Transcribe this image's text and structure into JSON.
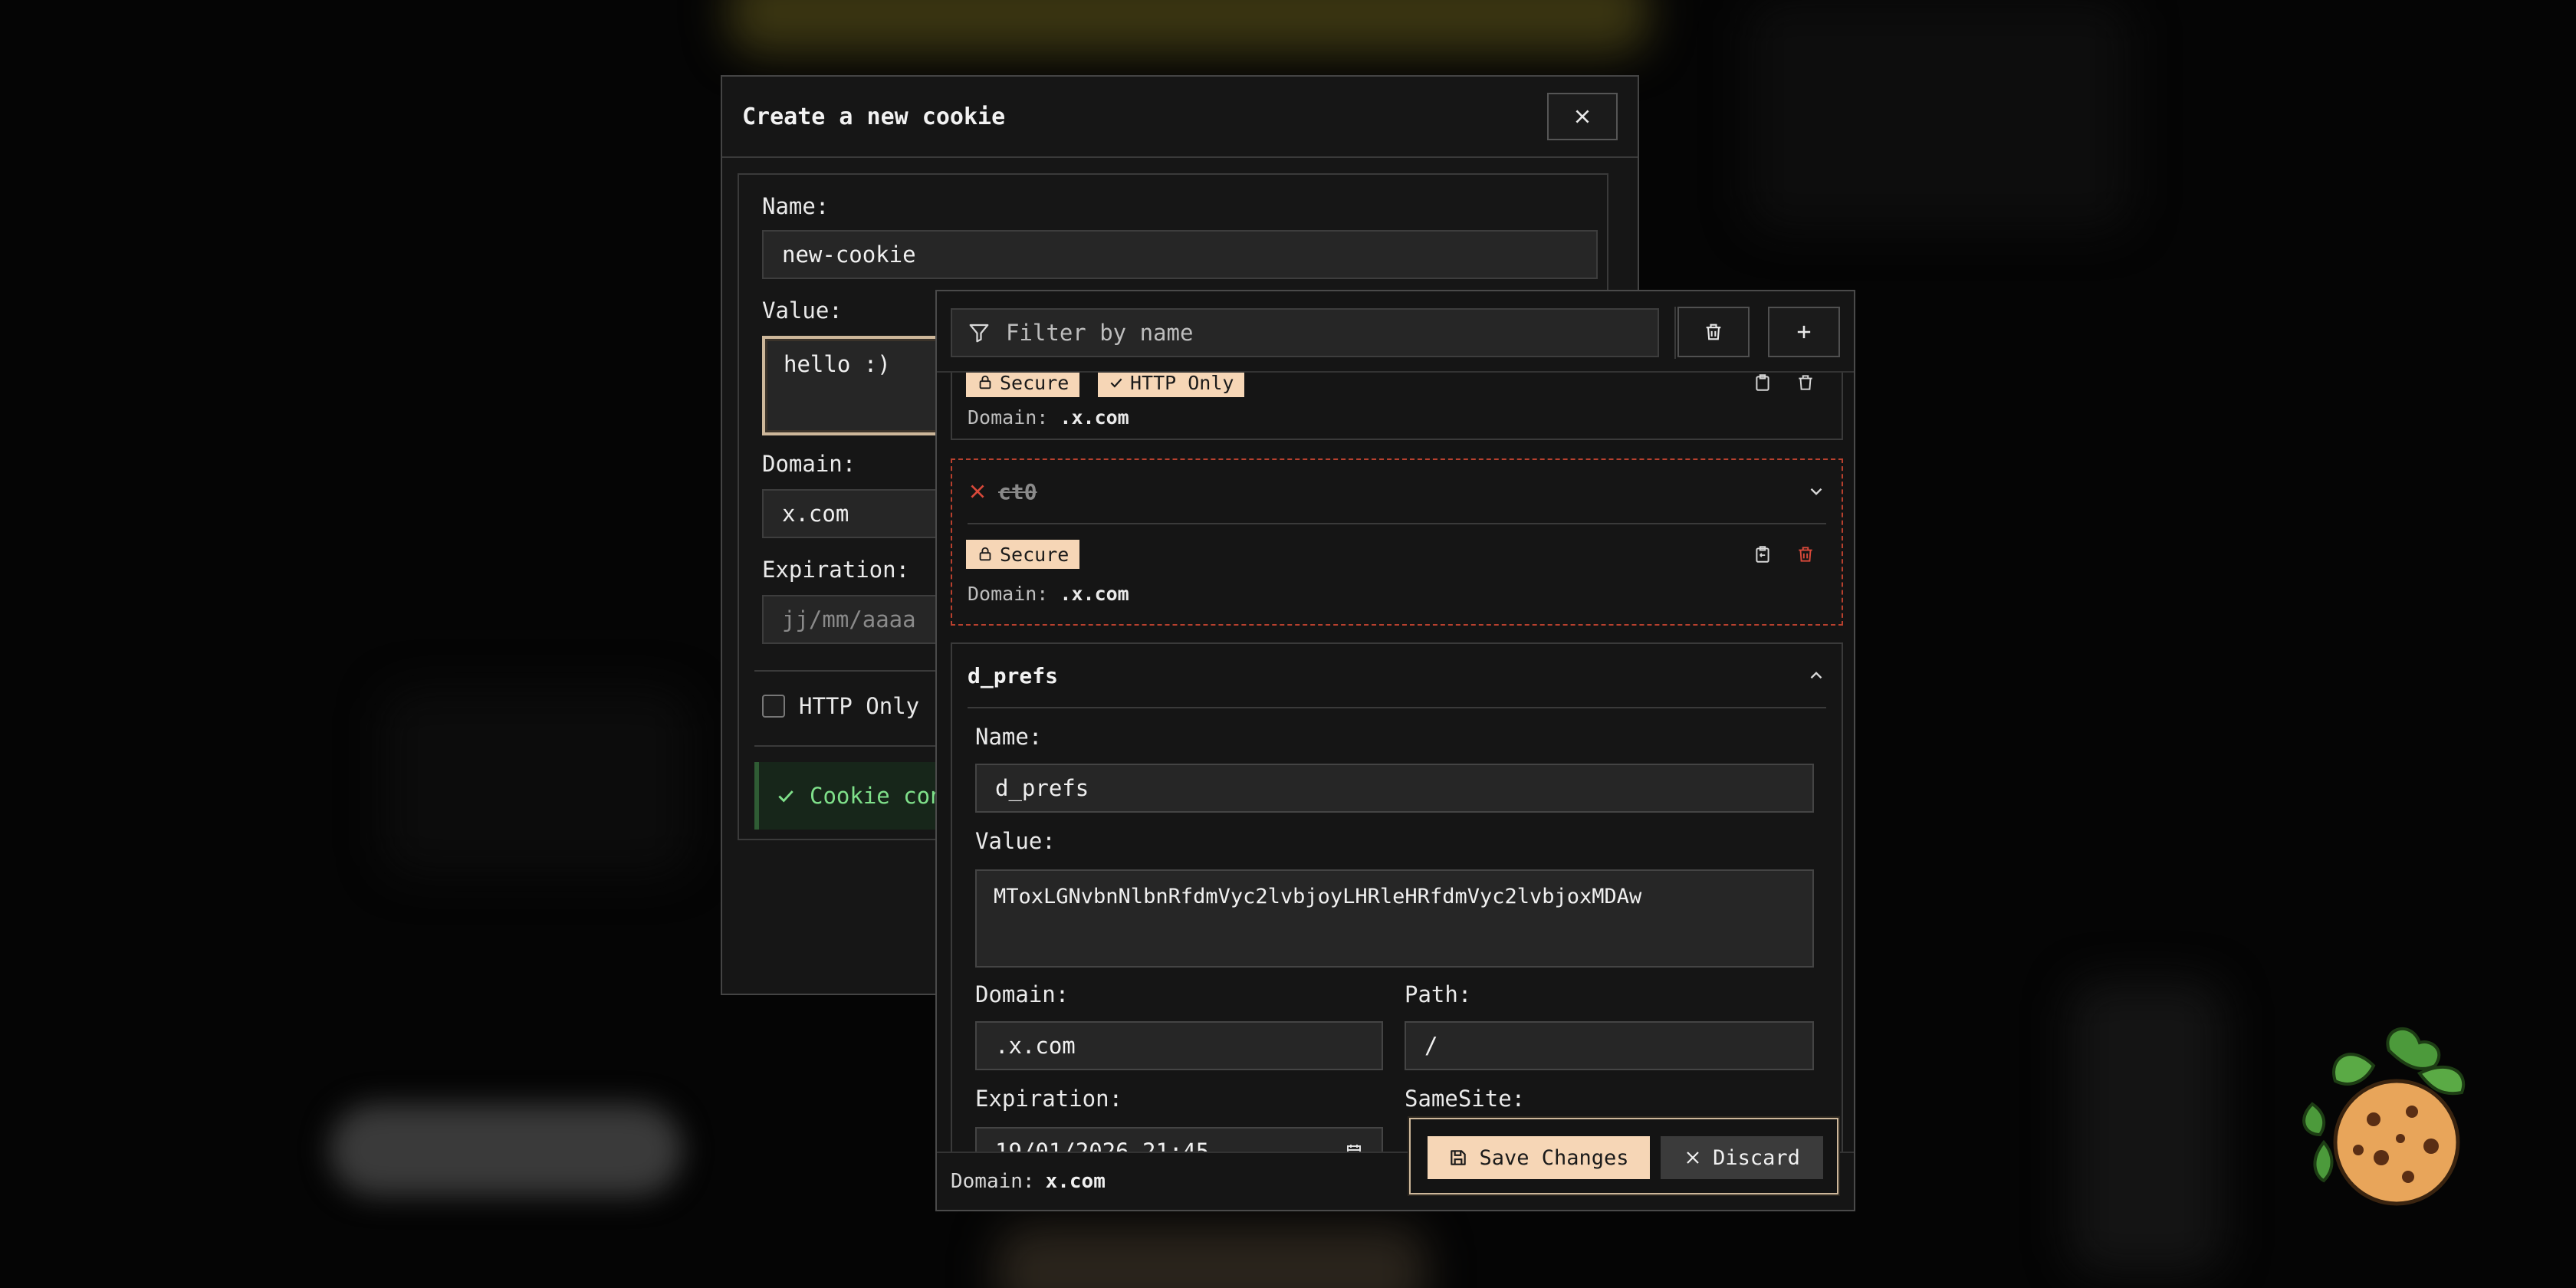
{
  "create_modal": {
    "title": "Create a new cookie",
    "name_label": "Name:",
    "name_value": "new-cookie",
    "value_label": "Value:",
    "value_value": "hello :)",
    "domain_label": "Domain:",
    "domain_value": "x.com",
    "expiration_label": "Expiration:",
    "expiration_placeholder": "jj/mm/aaaa",
    "http_only_label": "HTTP Only",
    "status_text": "Cookie con"
  },
  "toolbar": {
    "filter_placeholder": "Filter by name"
  },
  "cookies": [
    {
      "name": "",
      "badges": [
        "Secure",
        "HTTP Only"
      ],
      "domain_label": "Domain:",
      "domain": ".x.com"
    },
    {
      "name": "ct0",
      "badges": [
        "Secure"
      ],
      "domain_label": "Domain:",
      "domain": ".x.com",
      "deleted": true
    }
  ],
  "editor": {
    "cookie_name": "d_prefs",
    "name_label": "Name:",
    "name_value": "d_prefs",
    "value_label": "Value:",
    "value_value": "MToxLGNvbnNlbnRfdmVyc2lvbjoyLHRleHRfdmVyc2lvbjoxMDAw",
    "domain_label": "Domain:",
    "domain_value": ".x.com",
    "path_label": "Path:",
    "path_value": "/",
    "expiration_label": "Expiration:",
    "expiration_value": "19/01/2026 21:45",
    "samesite_label": "SameSite:"
  },
  "footer": {
    "domain_label": "Domain:",
    "domain_value": "x.com"
  },
  "actions": {
    "save_label": "Save Changes",
    "discard_label": "Discard"
  },
  "colors": {
    "accent": "#f6d6b6",
    "danger": "#d9493a",
    "success": "#7fe08a"
  }
}
